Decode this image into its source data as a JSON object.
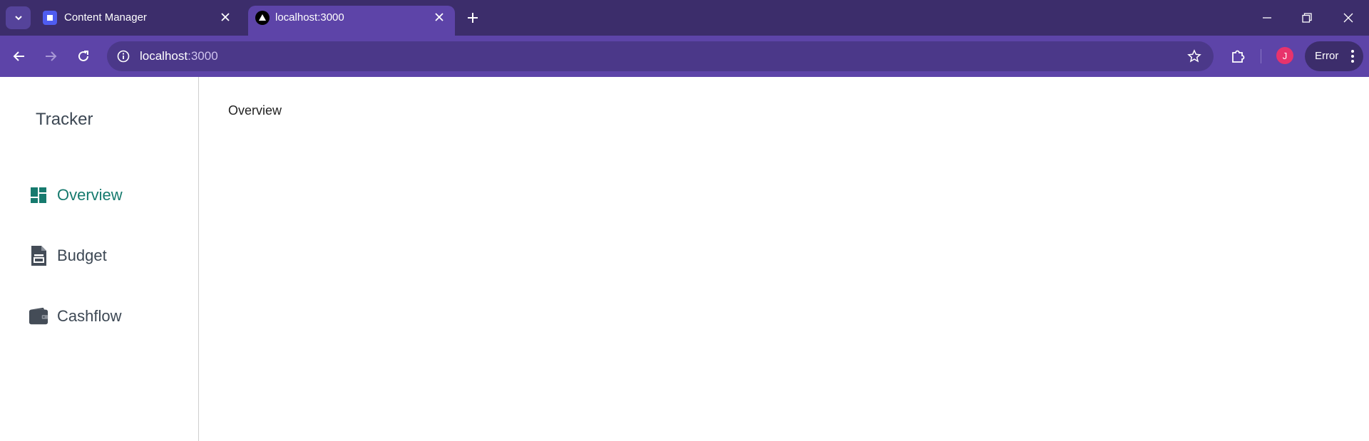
{
  "browser": {
    "tabs": [
      {
        "title": "Content Manager",
        "active": false,
        "favicon": "cube-icon"
      },
      {
        "title": "localhost:3000",
        "active": true,
        "favicon": "triangle-icon"
      }
    ],
    "url_host": "localhost",
    "url_port": ":3000",
    "profile_initial": "J",
    "error_label": "Error",
    "colors": {
      "frame": "#3c2d6b",
      "toolbar": "#5d44a8",
      "omnibox": "#4b3889",
      "avatar": "#e8336c"
    }
  },
  "app": {
    "brand": "Tracker",
    "nav": [
      {
        "label": "Overview",
        "icon": "dashboard-icon",
        "active": true
      },
      {
        "label": "Budget",
        "icon": "document-icon",
        "active": false
      },
      {
        "label": "Cashflow",
        "icon": "wallet-icon",
        "active": false
      }
    ],
    "page_title": "Overview",
    "colors": {
      "accent": "#167a6e",
      "text": "#3d4854"
    }
  }
}
